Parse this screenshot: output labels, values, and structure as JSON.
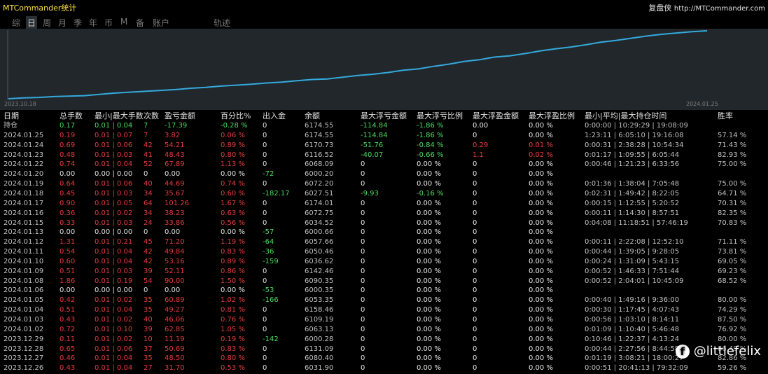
{
  "app": {
    "title": "MTCommander统计"
  },
  "brand": {
    "name": "复盘侠",
    "url": "http://MTCommander.com"
  },
  "tabs": [
    {
      "label": "综",
      "active": false
    },
    {
      "label": "日",
      "active": true
    },
    {
      "label": "周",
      "active": false
    },
    {
      "label": "月",
      "active": false
    },
    {
      "label": "季",
      "active": false
    },
    {
      "label": "年",
      "active": false
    },
    {
      "label": "币",
      "active": false
    },
    {
      "label": "M",
      "active": false
    },
    {
      "label": "备",
      "active": false
    },
    {
      "label": "账户",
      "active": false
    },
    {
      "label": "轨迹",
      "active": false
    }
  ],
  "colors": {
    "line": "#33aadd",
    "chart_bg": "#22272b",
    "loss": "#e23c3c",
    "gain": "#4ad860"
  },
  "chart_data": {
    "type": "line",
    "x_start_label": "2023.10.18",
    "x_end_label": "2024.01.25",
    "series": [
      {
        "values": [
          0,
          0.2,
          0.3,
          0.5,
          0.6,
          0.7,
          1.0,
          1.3,
          1.5,
          1.7,
          1.9,
          2.1,
          2.4,
          2.6,
          2.9,
          3.1,
          3.3,
          3.6,
          3.8,
          4.1,
          4.4,
          4.5,
          4.9,
          5.3,
          5.6,
          6.0,
          6.5,
          6.8,
          7.4,
          7.9,
          8.5,
          8.9,
          9.5,
          9.8,
          10.3,
          10.9,
          11.4,
          11.8,
          12.3,
          12.9,
          13.3,
          13.8,
          14.3,
          14.7,
          15.0,
          15.3,
          15.5
        ]
      }
    ],
    "grid": false
  },
  "table": {
    "headers": [
      "日期",
      "总手数",
      "最小|最大手数",
      "次数",
      "盈亏金额",
      "百分比%",
      "出入金",
      "余额",
      "最大浮亏金额",
      "最大浮亏比例",
      "最大浮盈金额",
      "最大浮盈比例",
      "最小|平均|最大持仓时间",
      "胜率"
    ],
    "rows": [
      [
        "持仓",
        "0.17",
        "0.01 | 0.04",
        "7",
        "-17.39",
        "-0.28 %",
        "0",
        "6174.55",
        "-114.84",
        "-1.86 %",
        "0.00",
        "0.00 %",
        "0:00:00 | 10:29:29 | 19:08:09",
        ""
      ],
      [
        "2024.01.25",
        "0.19",
        "0.01 | 0.07",
        "7",
        "3.82",
        "0.06 %",
        "0",
        "6174.55",
        "-114.84",
        "-1.86 %",
        "0",
        "0.00 %",
        "1:23:11 | 6:05:10 | 19:16:08",
        "57.14 %"
      ],
      [
        "2024.01.24",
        "0.69",
        "0.01 | 0.06",
        "42",
        "54.21",
        "0.89 %",
        "0",
        "6170.73",
        "-51.76",
        "-0.84 %",
        "0.29",
        "0.01 %",
        "0:00:31 | 2:38:28 | 10:54:34",
        "71.43 %"
      ],
      [
        "2024.01.23",
        "0.48",
        "0.01 | 0.03",
        "41",
        "48.43",
        "0.80 %",
        "0",
        "6116.52",
        "-40.07",
        "-0.66 %",
        "1.1",
        "0.02 %",
        "0:01:17 | 1:09:55 | 6:05:44",
        "82.93 %"
      ],
      [
        "2024.01.22",
        "0.74",
        "0.01 | 0.04",
        "52",
        "67.89",
        "1.13 %",
        "0",
        "6068.09",
        "0",
        "0.00 %",
        "0",
        "0.00 %",
        "0:00:46 | 1:21:23 | 6:33:56",
        "75.00 %"
      ],
      [
        "2024.01.20",
        "0.00",
        "0.00 | 0.00",
        "0",
        "0.00",
        "0.00 %",
        "-72",
        "6000.20",
        "0",
        "0.00 %",
        "0",
        "0.00 %",
        "",
        ""
      ],
      [
        "2024.01.19",
        "0.64",
        "0.01 | 0.06",
        "40",
        "44.69",
        "0.74 %",
        "0",
        "6072.20",
        "0",
        "0.00 %",
        "0",
        "0.00 %",
        "0:01:36 | 1:38:04 | 7:05:48",
        "75.00 %"
      ],
      [
        "2024.01.18",
        "0.45",
        "0.01 | 0.03",
        "34",
        "35.67",
        "0.60 %",
        "-182.17",
        "6027.51",
        "-9.93",
        "-0.16 %",
        "0",
        "0.00 %",
        "0:02:31 | 1:49:42 | 8:22:05",
        "64.71 %"
      ],
      [
        "2024.01.17",
        "0.90",
        "0.01 | 0.05",
        "64",
        "101.26",
        "1.67 %",
        "0",
        "6174.01",
        "0",
        "0.00 %",
        "0",
        "0.00 %",
        "0:00:15 | 1:12:55 | 5:20:52",
        "70.31 %"
      ],
      [
        "2024.01.16",
        "0.36",
        "0.01 | 0.02",
        "34",
        "38.23",
        "0.63 %",
        "0",
        "6072.75",
        "0",
        "0.00 %",
        "0",
        "0.00 %",
        "0:00:11 | 1:14:30 | 8:57:51",
        "82.35 %"
      ],
      [
        "2024.01.15",
        "0.33",
        "0.01 | 0.03",
        "24",
        "33.86",
        "0.56 %",
        "0",
        "6034.52",
        "0",
        "0.00 %",
        "0",
        "0.00 %",
        "0:04:08 | 11:18:51 | 57:46:19",
        "70.83 %"
      ],
      [
        "2024.01.13",
        "0.00",
        "0.00 | 0.00",
        "0",
        "0.00",
        "0.00 %",
        "-57",
        "6000.66",
        "0",
        "0.00 %",
        "0",
        "0.00 %",
        "",
        ""
      ],
      [
        "2024.01.12",
        "1.31",
        "0.01 | 0.21",
        "45",
        "71.20",
        "1.19 %",
        "-64",
        "6057.66",
        "0",
        "0.00 %",
        "0",
        "0.00 %",
        "0:00:11 | 2:22:08 | 12:52:10",
        "71.11 %"
      ],
      [
        "2024.01.11",
        "0.54",
        "0.01 | 0.04",
        "42",
        "49.84",
        "0.83 %",
        "-36",
        "6050.46",
        "0",
        "0.00 %",
        "0",
        "0.00 %",
        "0:00:44 | 1:39:05 | 9:28:05",
        "73.81 %"
      ],
      [
        "2024.01.10",
        "0.60",
        "0.01 | 0.04",
        "42",
        "53.16",
        "0.89 %",
        "-159",
        "6036.62",
        "0",
        "0.00 %",
        "0",
        "0.00 %",
        "0:00:24 | 1:31:09 | 5:43:15",
        "69.05 %"
      ],
      [
        "2024.01.09",
        "0.51",
        "0.01 | 0.03",
        "39",
        "52.11",
        "0.86 %",
        "0",
        "6142.46",
        "0",
        "0.00 %",
        "0",
        "0.00 %",
        "0:00:52 | 1:46:33 | 7:51:44",
        "69.23 %"
      ],
      [
        "2024.01.08",
        "1.86",
        "0.01 | 0.19",
        "54",
        "90.00",
        "1.50 %",
        "0",
        "6090.35",
        "0",
        "0.00 %",
        "0",
        "0.00 %",
        "0:00:52 | 2:04:01 | 10:45:09",
        "68.52 %"
      ],
      [
        "2024.01.06",
        "0.00",
        "0.00 | 0.00",
        "0",
        "0.00",
        "0.00 %",
        "-53",
        "6000.35",
        "0",
        "0.00 %",
        "0",
        "0.00 %",
        "",
        ""
      ],
      [
        "2024.01.05",
        "0.42",
        "0.01 | 0.02",
        "35",
        "60.89",
        "1.02 %",
        "-166",
        "6053.35",
        "0",
        "0.00 %",
        "0",
        "0.00 %",
        "0:00:40 | 1:49:16 | 9:36:00",
        "80.00 %"
      ],
      [
        "2024.01.04",
        "0.51",
        "0.01 | 0.04",
        "35",
        "49.27",
        "0.81 %",
        "0",
        "6158.46",
        "0",
        "0.00 %",
        "0",
        "0.00 %",
        "0:00:30 | 1:17:45 | 4:07:43",
        "74.29 %"
      ],
      [
        "2024.01.03",
        "0.43",
        "0.01 | 0.02",
        "40",
        "46.06",
        "0.76 %",
        "0",
        "6109.19",
        "0",
        "0.00 %",
        "0",
        "0.00 %",
        "0:00:56 | 1:03:10 | 8:14:11",
        "87.50 %"
      ],
      [
        "2024.01.02",
        "0.72",
        "0.01 | 0.10",
        "39",
        "62.85",
        "1.05 %",
        "0",
        "6063.13",
        "0",
        "0.00 %",
        "0",
        "0.00 %",
        "0:01:09 | 1:10:40 | 5:46:48",
        "76.92 %"
      ],
      [
        "2023.12.29",
        "0.11",
        "0.01 | 0.02",
        "10",
        "11.19",
        "0.19 %",
        "-142",
        "6000.28",
        "0",
        "0.00 %",
        "0",
        "0.00 %",
        "0:10:46 | 1:22:37 | 4:13:24",
        "80.00 %"
      ],
      [
        "2023.12.28",
        "0.65",
        "0.01 | 0.06",
        "37",
        "50.69",
        "0.83 %",
        "0",
        "6131.09",
        "0",
        "0.00 %",
        "0",
        "0.00 %",
        "0:00:44 | 2:27:56 | 8:44:58",
        "86.49 %"
      ],
      [
        "2023.12.27",
        "0.46",
        "0.01 | 0.04",
        "35",
        "48.50",
        "0.80 %",
        "0",
        "6080.40",
        "0",
        "0.00 %",
        "0",
        "0.00 %",
        "0:01:19 | 3:08:21 | 18:00:27",
        "82.86 %"
      ],
      [
        "2023.12.26",
        "0.43",
        "0.01 | 0.04",
        "27",
        "31.70",
        "0.53 %",
        "0",
        "6031.90",
        "0",
        "0.00 %",
        "0",
        "0.00 %",
        "0:00:51 | 20:41:13 | 79:32:09",
        "59.26 %"
      ]
    ]
  },
  "watermark": {
    "icon": "facebook-icon",
    "text": "@littlefelix"
  }
}
